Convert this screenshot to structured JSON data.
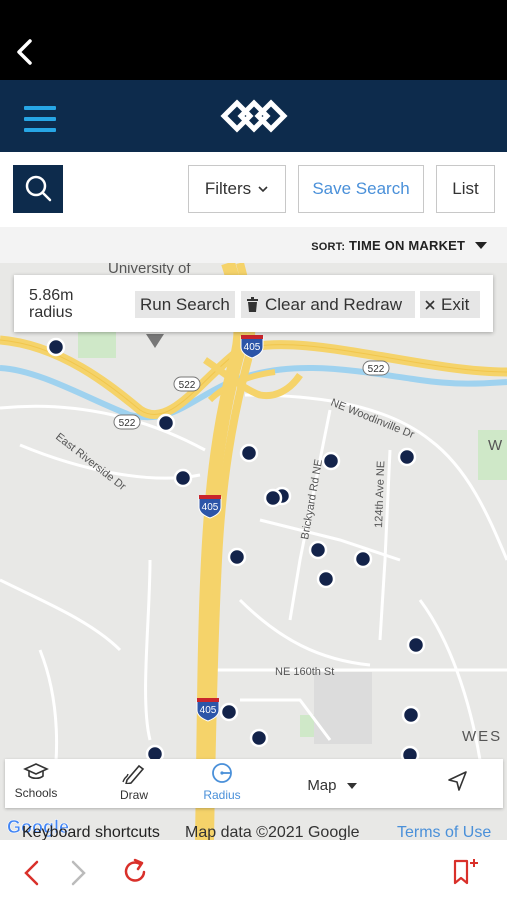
{
  "top": {
    "back_icon": "chevron-left-icon"
  },
  "nav": {
    "menu_icon": "hamburger-icon",
    "logo_icon": "brand-logo"
  },
  "search": {
    "search_icon": "search-icon",
    "filters_label": "Filters",
    "save_label": "Save Search",
    "list_label": "List"
  },
  "sort": {
    "prefix": "SORT:",
    "value": "TIME ON MARKET"
  },
  "map": {
    "labels": {
      "university": "University of",
      "road1": "522",
      "road2": "522",
      "road3": "522",
      "i405a": "405",
      "i405b": "405",
      "i405c": "405",
      "woodinville": "NE Woodinville Dr",
      "riverside": "East Riverside Dr",
      "brickyard": "Brickyard Rd NE",
      "ave124": "124th Ave NE",
      "st160": "NE 160th St",
      "wes": "WES",
      "w": "W"
    }
  },
  "radius_panel": {
    "radius": "5.86m radius",
    "run_search": "Run Search",
    "clear_redraw": "Clear and Redraw",
    "exit": "Exit"
  },
  "tools": {
    "schools": "Schools",
    "draw": "Draw",
    "radius": "Radius",
    "map": "Map"
  },
  "attribution": {
    "keyboard": "Keyboard shortcuts",
    "mapdata": "Map data ©2021 Google",
    "terms": "Terms of Use",
    "google": "Google"
  },
  "colors": {
    "navy": "#0d2b4c",
    "accent_blue": "#4a90d9",
    "hamburger": "#27a6e5",
    "browser_red": "#d9302a"
  }
}
